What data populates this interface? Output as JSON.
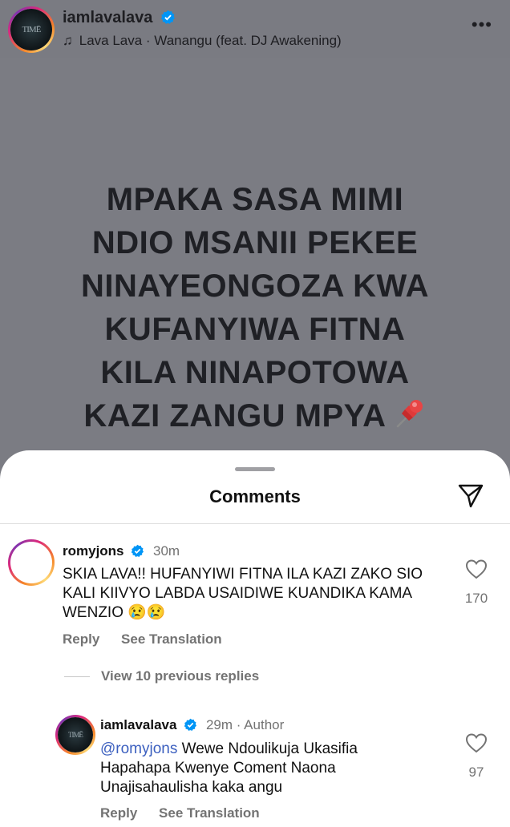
{
  "header": {
    "username": "iamlavalava",
    "song": "Lava Lava · Wanangu (feat. DJ Awakening)",
    "more": "•••"
  },
  "post": {
    "lines": [
      "MPAKA SASA MIMI",
      "NDIO MSANII PEKEE",
      "NINAYEONGOZA KWA",
      "KUFANYIWA FITNA",
      "KILA NINAPOTOWA",
      "KAZI ZANGU MPYA"
    ]
  },
  "comments_sheet": {
    "title": "Comments",
    "comment": {
      "username": "romyjons",
      "time": "30m",
      "text": "SKIA LAVA!! HUFANYIWI FITNA ILA KAZI ZAKO SIO KALI KIIVYO LABDA USAIDIWE KUANDIKA KAMA WENZIO 😢😢",
      "reply": "Reply",
      "see_translation": "See Translation",
      "likes": "170"
    },
    "view_replies": "View 10 previous replies",
    "reply_comment": {
      "username": "iamlavalava",
      "time": "29m · Author",
      "mention": "@romyjons",
      "text": " Wewe Ndoulikuja Ukasifia Hapahapa Kwenye Coment Naona Unajisahaulisha kaka angu",
      "reply": "Reply",
      "see_translation": "See Translation",
      "likes": "97"
    }
  },
  "colors": {
    "verified": "#0095f6",
    "backdrop": "#7b7c83"
  }
}
